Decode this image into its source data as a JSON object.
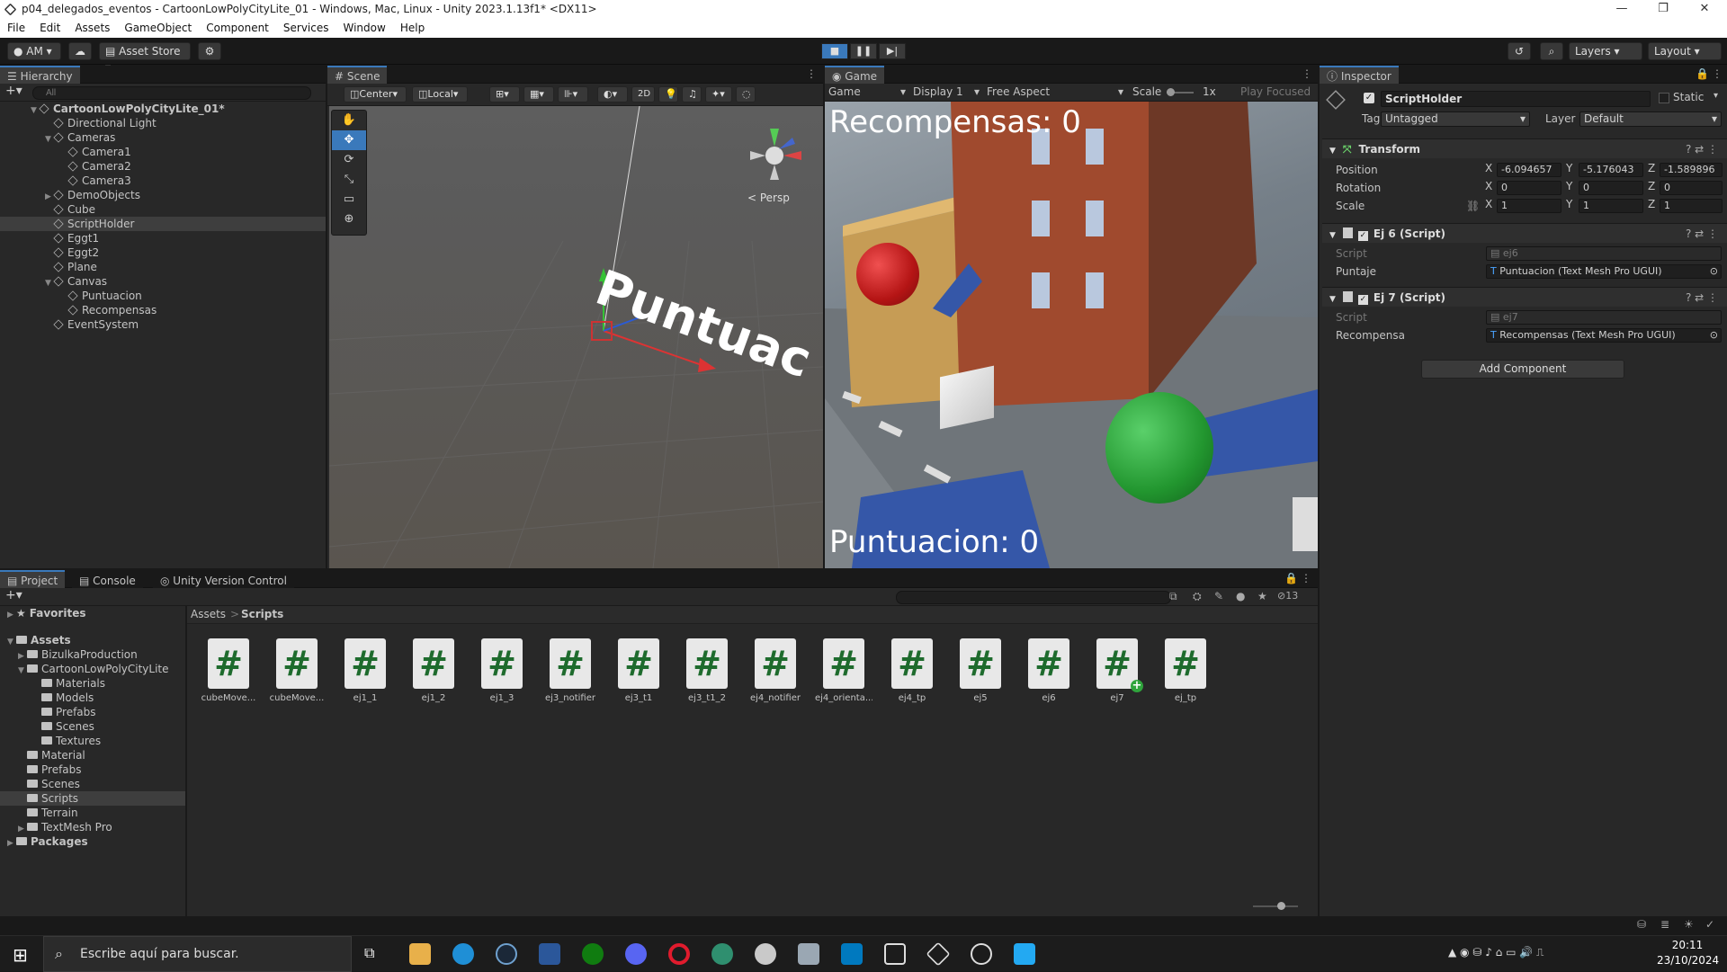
{
  "window": {
    "title": "p04_delegados_eventos - CartoonLowPolyCityLite_01 - Windows, Mac, Linux - Unity 2023.1.13f1* <DX11>",
    "minimize": "—",
    "maximize": "❐",
    "close": "✕"
  },
  "menu": [
    "File",
    "Edit",
    "Assets",
    "GameObject",
    "Component",
    "Services",
    "Window",
    "Help"
  ],
  "toolbar": {
    "account": "AM",
    "asset_store": "Asset Store",
    "layers": "Layers",
    "layout": "Layout"
  },
  "hierarchy": {
    "tab": "Hierarchy",
    "search_placeholder": "All",
    "root": "CartoonLowPolyCityLite_01*",
    "items": [
      {
        "label": "Directional Light",
        "depth": 1,
        "sel": false,
        "arrow": ""
      },
      {
        "label": "Cameras",
        "depth": 1,
        "sel": false,
        "arrow": "▼"
      },
      {
        "label": "Camera1",
        "depth": 2,
        "sel": false,
        "arrow": ""
      },
      {
        "label": "Camera2",
        "depth": 2,
        "sel": false,
        "arrow": ""
      },
      {
        "label": "Camera3",
        "depth": 2,
        "sel": false,
        "arrow": ""
      },
      {
        "label": "DemoObjects",
        "depth": 1,
        "sel": false,
        "arrow": "▶"
      },
      {
        "label": "Cube",
        "depth": 1,
        "sel": false,
        "arrow": ""
      },
      {
        "label": "ScriptHolder",
        "depth": 1,
        "sel": true,
        "arrow": ""
      },
      {
        "label": "Eggt1",
        "depth": 1,
        "sel": false,
        "arrow": ""
      },
      {
        "label": "Eggt2",
        "depth": 1,
        "sel": false,
        "arrow": ""
      },
      {
        "label": "Plane",
        "depth": 1,
        "sel": false,
        "arrow": ""
      },
      {
        "label": "Canvas",
        "depth": 1,
        "sel": false,
        "arrow": "▼"
      },
      {
        "label": "Puntuacion",
        "depth": 2,
        "sel": false,
        "arrow": ""
      },
      {
        "label": "Recompensas",
        "depth": 2,
        "sel": false,
        "arrow": ""
      },
      {
        "label": "EventSystem",
        "depth": 1,
        "sel": false,
        "arrow": ""
      }
    ]
  },
  "scene": {
    "tab": "Scene",
    "pivot": "Center",
    "space": "Local",
    "mode2d": "2D",
    "persp": "< Persp",
    "world_text": "Puntuac"
  },
  "game": {
    "tab": "Game",
    "view": "Game",
    "display": "Display 1",
    "aspect": "Free Aspect",
    "scale_label": "Scale",
    "scale_value": "1x",
    "play_focused": "Play Focused",
    "recompensas": "Recompensas: 0",
    "puntuacion": "Puntuacion: 0"
  },
  "inspector": {
    "tab": "Inspector",
    "object": "ScriptHolder",
    "static": "Static",
    "tag_label": "Tag",
    "tag": "Untagged",
    "layer_label": "Layer",
    "layer": "Default",
    "transform": {
      "title": "Transform",
      "position_label": "Position",
      "rotation_label": "Rotation",
      "scale_label": "Scale",
      "px": "-6.094657",
      "py": "-5.176043",
      "pz": "-1.589896",
      "rx": "0",
      "ry": "0",
      "rz": "0",
      "sx": "1",
      "sy": "1",
      "sz": "1"
    },
    "ej6": {
      "title": "Ej 6 (Script)",
      "script_label": "Script",
      "script": "ej6",
      "field_label": "Puntaje",
      "field": "Puntuacion (Text Mesh Pro UGUI)"
    },
    "ej7": {
      "title": "Ej 7 (Script)",
      "script_label": "Script",
      "script": "ej7",
      "field_label": "Recompensa",
      "field": "Recompensas (Text Mesh Pro UGUI)"
    },
    "add_component": "Add Component"
  },
  "project": {
    "tab_project": "Project",
    "tab_console": "Console",
    "tab_vc": "Unity Version Control",
    "hidden_count": "13",
    "favorites": "Favorites",
    "assets": "Assets",
    "packages": "Packages",
    "tree": [
      {
        "label": "BizulkaProduction",
        "x": 30,
        "arrow": "▶",
        "sel": false
      },
      {
        "label": "CartoonLowPolyCityLite",
        "x": 30,
        "arrow": "▼",
        "sel": false
      },
      {
        "label": "Materials",
        "x": 46,
        "arrow": "",
        "sel": false
      },
      {
        "label": "Models",
        "x": 46,
        "arrow": "",
        "sel": false
      },
      {
        "label": "Prefabs",
        "x": 46,
        "arrow": "",
        "sel": false
      },
      {
        "label": "Scenes",
        "x": 46,
        "arrow": "",
        "sel": false
      },
      {
        "label": "Textures",
        "x": 46,
        "arrow": "",
        "sel": false
      },
      {
        "label": "Material",
        "x": 30,
        "arrow": "",
        "sel": false
      },
      {
        "label": "Prefabs",
        "x": 30,
        "arrow": "",
        "sel": false
      },
      {
        "label": "Scenes",
        "x": 30,
        "arrow": "",
        "sel": false
      },
      {
        "label": "Scripts",
        "x": 30,
        "arrow": "",
        "sel": true
      },
      {
        "label": "Terrain",
        "x": 30,
        "arrow": "",
        "sel": false
      },
      {
        "label": "TextMesh Pro",
        "x": 30,
        "arrow": "▶",
        "sel": false
      }
    ],
    "breadcrumb_root": "Assets",
    "breadcrumb_sep": ">",
    "breadcrumb_leaf": "Scripts",
    "files": [
      "cubeMove...",
      "cubeMove...",
      "ej1_1",
      "ej1_2",
      "ej1_3",
      "ej3_notifier",
      "ej3_t1",
      "ej3_t1_2",
      "ej4_notifier",
      "ej4_orienta...",
      "ej4_tp",
      "ej5",
      "ej6",
      "ej7",
      "ej_tp"
    ]
  },
  "taskbar": {
    "search_placeholder": "Escribe aquí para buscar.",
    "time": "20:11",
    "date": "23/10/2024"
  },
  "colors": {
    "accent": "#3a79bb",
    "unity_bg": "#282828",
    "taskbar": "#1c1c1c"
  }
}
